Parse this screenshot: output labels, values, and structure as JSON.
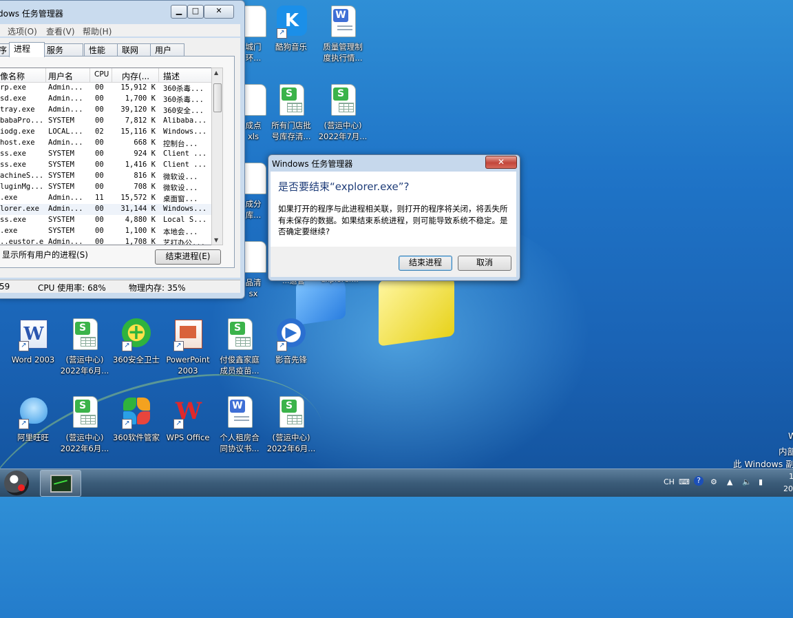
{
  "task_manager": {
    "title": "dows 任务管理器",
    "menu": [
      "选项(O)",
      "查看(V)",
      "帮助(H)"
    ],
    "tabs": [
      "序",
      "进程",
      "服务",
      "性能",
      "联网",
      "用户"
    ],
    "columns": [
      "像名称",
      "用户名",
      "CPU",
      "内存(...",
      "描述"
    ],
    "rows": [
      [
        "rp.exe",
        "Admin...",
        "00",
        "15,912 K",
        "360杀毒..."
      ],
      [
        "sd.exe",
        "Admin...",
        "00",
        "1,700 K",
        "360杀毒..."
      ],
      [
        "tray.exe",
        "Admin...",
        "00",
        "39,120 K",
        "360安全..."
      ],
      [
        "babaPro...",
        "SYSTEM",
        "00",
        "7,812 K",
        "Alibaba..."
      ],
      [
        "iodg.exe",
        "LOCAL...",
        "02",
        "15,116 K",
        "Windows..."
      ],
      [
        "host.exe",
        "Admin...",
        "00",
        "668 K",
        "控制台..."
      ],
      [
        "ss.exe",
        "SYSTEM",
        "00",
        "924 K",
        "Client ..."
      ],
      [
        "ss.exe",
        "SYSTEM",
        "00",
        "1,416 K",
        "Client ..."
      ],
      [
        "achineS...",
        "SYSTEM",
        "00",
        "816 K",
        "微软设..."
      ],
      [
        "luginMg...",
        "SYSTEM",
        "00",
        "708 K",
        "微软设..."
      ],
      [
        ".exe",
        "Admin...",
        "11",
        "15,572 K",
        "桌面窗..."
      ],
      [
        "lorer.exe",
        "Admin...",
        "00",
        "31,144 K",
        "Windows..."
      ],
      [
        "ss.exe",
        "SYSTEM",
        "00",
        "4,880 K",
        "Local S..."
      ],
      [
        ".exe",
        "SYSTEM",
        "00",
        "1,100 K",
        "本地会..."
      ],
      [
        "..eustor.exe",
        "Admin...",
        "00",
        "1,708 K",
        "艺打办公..."
      ]
    ],
    "show_all": "显示所有用户的进程(S)",
    "end_process_button": "结束进程(E)",
    "status": [
      "59",
      "CPU 使用率: 68%",
      "物理内存: 35%"
    ]
  },
  "dialog": {
    "title": "Windows 任务管理器",
    "close": "✕",
    "instruction": "是否要结束“explorer.exe”?",
    "message": "如果打开的程序与此进程相关联，则打开的程序将关闭，将丢失所有未保存的数据。如果结束系统进程，则可能导致系统不稳定。是否确定要继续?",
    "confirm": "结束进程",
    "cancel": "取消"
  },
  "desktop_icons": [
    {
      "line1": "城门",
      "line2": "环...",
      "type": "partial"
    },
    {
      "line1": "酷狗音乐",
      "line2": "",
      "type": "kugou"
    },
    {
      "line1": "质量管理制",
      "line2": "度执行情...",
      "type": "wps-w"
    },
    {
      "line1": "成点",
      "line2": "xls",
      "type": "partial"
    },
    {
      "line1": "所有门店批",
      "line2": "号库存清...",
      "type": "wps-s"
    },
    {
      "line1": "(营运中心)",
      "line2": "2022年7月...",
      "type": "wps-s"
    },
    {
      "line1": "成分",
      "line2": "库...",
      "type": "partial"
    },
    {
      "line1": "品清",
      "line2": "sx",
      "type": "partial"
    },
    {
      "line1": "Word 2003",
      "line2": "",
      "type": "word"
    },
    {
      "line1": "(营运中心)",
      "line2": "2022年6月...",
      "type": "wps-s"
    },
    {
      "line1": "360安全卫士",
      "line2": "",
      "type": "360"
    },
    {
      "line1": "PowerPoint",
      "line2": "2003",
      "type": "ppt"
    },
    {
      "line1": "付俊鑫家庭",
      "line2": "成员疫苗...",
      "type": "wps-s"
    },
    {
      "line1": "影音先锋",
      "line2": "",
      "type": "player"
    },
    {
      "line1": "阿里旺旺",
      "line2": "",
      "type": "wangwang"
    },
    {
      "line1": "(营运中心)",
      "line2": "2022年6月...",
      "type": "wps-s"
    },
    {
      "line1": "360软件管家",
      "line2": "",
      "type": "360soft"
    },
    {
      "line1": "WPS Office",
      "line2": "",
      "type": "wps"
    },
    {
      "line1": "个人租房合",
      "line2": "同协议书...",
      "type": "wps-w"
    },
    {
      "line1": "(营运中心)",
      "line2": "2022年6月...",
      "type": "wps-s"
    }
  ],
  "background_labels": [
    "...运管",
    "explorer..."
  ],
  "watermark": [
    "W",
    "内部",
    "此 Windows 副"
  ],
  "taskbar": {
    "lang": "CH",
    "clock_line1": "1",
    "clock_line2": "20"
  },
  "colors": {
    "wps_sheet": "#3bb34a",
    "wps_writer": "#3f6fd6",
    "accent": "#1e3c78"
  }
}
